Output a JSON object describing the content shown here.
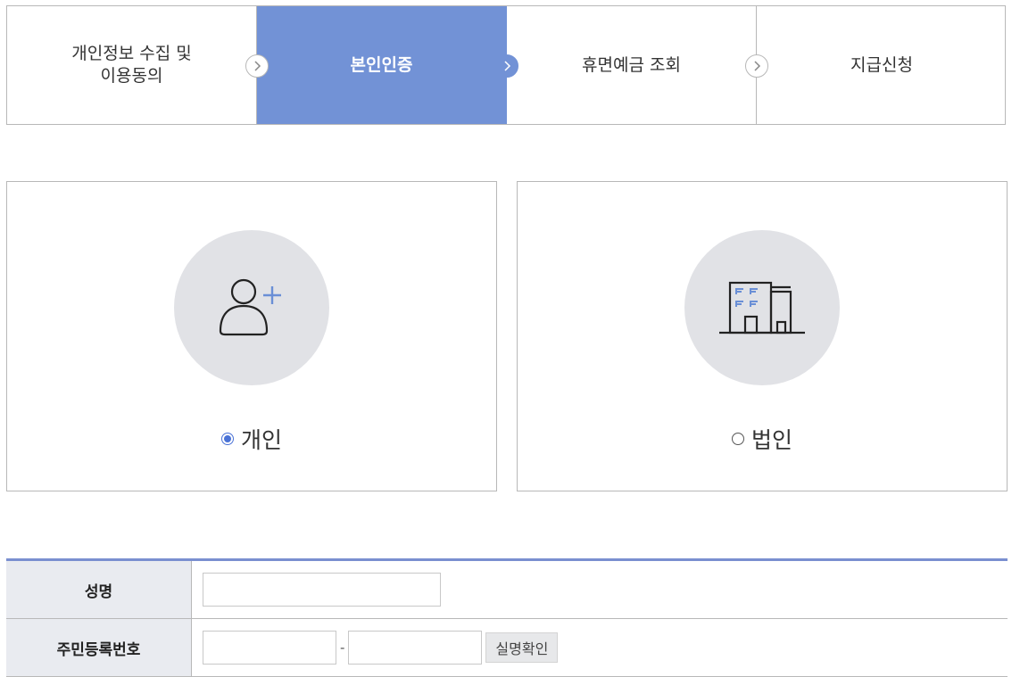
{
  "steps": [
    {
      "label": "개인정보 수집 및\n이용동의",
      "active": false
    },
    {
      "label": "본인인증",
      "active": true
    },
    {
      "label": "휴면예금 조회",
      "active": false
    },
    {
      "label": "지급신청",
      "active": false
    }
  ],
  "cards": {
    "personal": {
      "label": "개인",
      "selected": true,
      "icon": "person-add-icon"
    },
    "corporate": {
      "label": "법인",
      "selected": false,
      "icon": "building-icon"
    }
  },
  "form": {
    "name_label": "성명",
    "name_value": "",
    "rrn_label": "주민등록번호",
    "rrn_first_value": "",
    "rrn_separator": "-",
    "rrn_second_value": "",
    "verify_button": "실명확인"
  },
  "colors": {
    "accent": "#7292d6",
    "radio_checked": "#4a72d6",
    "icon_bg": "#e1e2e6",
    "form_top_border": "#7a8fd0",
    "header_cell_bg": "#e9ebf0"
  }
}
